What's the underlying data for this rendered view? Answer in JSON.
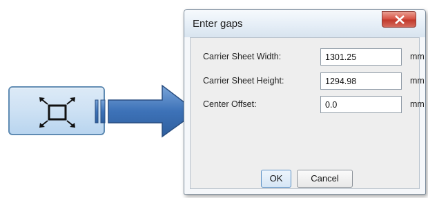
{
  "tool_button": {
    "icon": "fit-to-frame-icon"
  },
  "dialog": {
    "title": "Enter gaps",
    "close_icon": "close-icon",
    "fields": [
      {
        "label": "Carrier Sheet Width:",
        "value": "1301.25",
        "unit": "mm"
      },
      {
        "label": "Carrier Sheet Height:",
        "value": "1294.98",
        "unit": "mm"
      },
      {
        "label": "Center Offset:",
        "value": "0.0",
        "unit": "mm"
      }
    ],
    "ok_label": "OK",
    "cancel_label": "Cancel"
  },
  "colors": {
    "arrow_fill": "#4a7fc1",
    "close_button": "#d9584a",
    "tool_button_bg": "#cfe2f4"
  }
}
